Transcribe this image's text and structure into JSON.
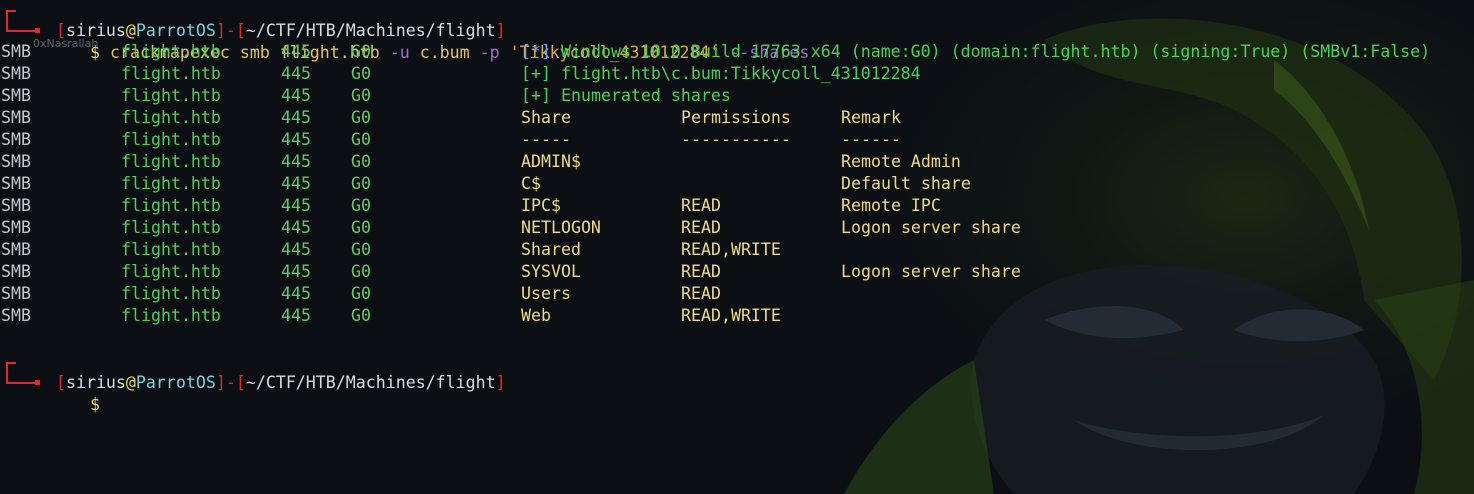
{
  "colors": {
    "background": "#0b0f14",
    "prompt_bracket": "#e3262b",
    "user": "#d8dde3",
    "host": "#6fd6e4",
    "path": "#d8dde3",
    "command": "#e8c64a",
    "flag": "#9f6bd6",
    "string": "#e2a832",
    "output_green": "#46d35a",
    "output_yellow": "#f0dc78"
  },
  "prompt1": {
    "user": "sirius",
    "at": "@",
    "host": "ParrotOS",
    "dash": "-",
    "path": "~/CTF/HTB/Machines/flight",
    "dollar": "$",
    "command": "crackmapexec smb flight.htb",
    "flag_u": "-u",
    "user_arg": "c.bum",
    "flag_p": "-p",
    "password": "'Tikkycoll_431012284'",
    "flag_shares": "--shares"
  },
  "watermark": "0xNasrallah",
  "output": [
    {
      "proto": "SMB",
      "host": "flight.htb",
      "port": "445",
      "name": "G0",
      "msg_tag": "[*]",
      "msg": "Windows 10.0 Build 17763 x64 (name:G0) (domain:flight.htb) (signing:True) (SMBv1:False)"
    },
    {
      "proto": "SMB",
      "host": "flight.htb",
      "port": "445",
      "name": "G0",
      "msg_tag": "[+]",
      "msg": "flight.htb\\c.bum:Tikkycoll_431012284"
    },
    {
      "proto": "SMB",
      "host": "flight.htb",
      "port": "445",
      "name": "G0",
      "msg_tag": "[+]",
      "msg": "Enumerated shares"
    }
  ],
  "share_table": {
    "headers": [
      "Share",
      "Permissions",
      "Remark"
    ],
    "separators": [
      "-----",
      "-----------",
      "------"
    ],
    "rows": [
      {
        "share": "ADMIN$",
        "perm": "",
        "remark": "Remote Admin"
      },
      {
        "share": "C$",
        "perm": "",
        "remark": "Default share"
      },
      {
        "share": "IPC$",
        "perm": "READ",
        "remark": "Remote IPC"
      },
      {
        "share": "NETLOGON",
        "perm": "READ",
        "remark": "Logon server share"
      },
      {
        "share": "Shared",
        "perm": "READ,WRITE",
        "remark": ""
      },
      {
        "share": "SYSVOL",
        "perm": "READ",
        "remark": "Logon server share"
      },
      {
        "share": "Users",
        "perm": "READ",
        "remark": ""
      },
      {
        "share": "Web",
        "perm": "READ,WRITE",
        "remark": ""
      }
    ],
    "row_prefix": {
      "proto": "SMB",
      "host": "flight.htb",
      "port": "445",
      "name": "G0"
    }
  },
  "prompt2": {
    "user": "sirius",
    "at": "@",
    "host": "ParrotOS",
    "dash": "-",
    "path": "~/CTF/HTB/Machines/flight",
    "dollar": "$"
  }
}
